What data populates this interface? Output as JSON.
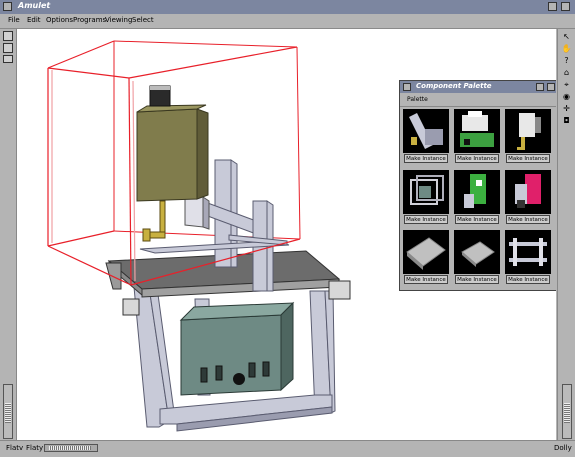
{
  "app": {
    "title": "Amulet"
  },
  "menu": [
    "File",
    "Edit",
    "Options",
    "Programs",
    "Viewing",
    "Select"
  ],
  "palette": {
    "title": "Component Palette",
    "menu_label": "Palette",
    "button_label": "Make Instance",
    "items": [
      {
        "icon": "bracket-arm-icon"
      },
      {
        "icon": "green-printer-icon"
      },
      {
        "icon": "yellow-gripper-icon"
      },
      {
        "icon": "cage-frame-icon"
      },
      {
        "icon": "green-clamp-icon"
      },
      {
        "icon": "pink-clamp-icon"
      },
      {
        "icon": "flat-plate-icon"
      },
      {
        "icon": "small-plate-icon"
      },
      {
        "icon": "i-beam-icon"
      }
    ]
  },
  "status": {
    "left1": "Flatv",
    "left2": "Flaty",
    "right": "Dolly"
  },
  "right_toolbar": [
    {
      "icon": "arrow-icon",
      "glyph": "↖"
    },
    {
      "icon": "hand-icon",
      "glyph": "✋"
    },
    {
      "icon": "help-icon",
      "glyph": "?"
    },
    {
      "icon": "home-icon",
      "glyph": "⌂"
    },
    {
      "icon": "pin-icon",
      "glyph": "⌖"
    },
    {
      "icon": "eye-icon",
      "glyph": "◉"
    },
    {
      "icon": "crosshair-icon",
      "glyph": "✛"
    },
    {
      "icon": "camera-icon",
      "glyph": "◘"
    }
  ],
  "colors": {
    "titlebar": "#7c86a0",
    "bbox": "#e8202a",
    "chrome": "#b4b4b4"
  }
}
